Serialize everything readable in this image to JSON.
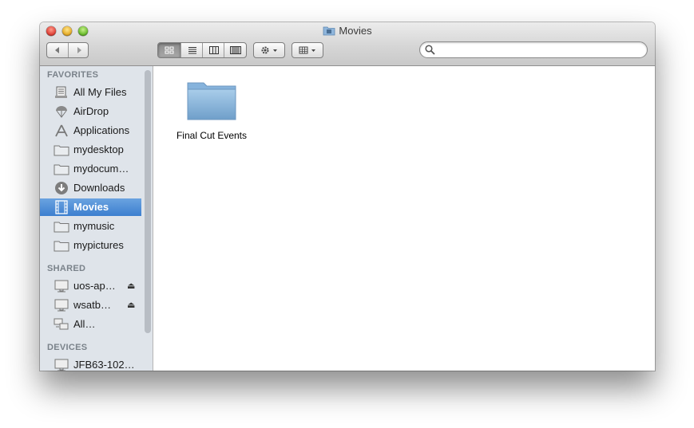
{
  "window": {
    "title": "Movies"
  },
  "toolbar": {
    "search_placeholder": ""
  },
  "sidebar": {
    "sections": {
      "favorites": "FAVORITES",
      "shared": "SHARED",
      "devices": "DEVICES"
    },
    "favorites": [
      {
        "label": "All My Files",
        "icon": "all-files-icon"
      },
      {
        "label": "AirDrop",
        "icon": "airdrop-icon"
      },
      {
        "label": "Applications",
        "icon": "applications-icon"
      },
      {
        "label": "mydesktop",
        "icon": "folder-icon"
      },
      {
        "label": "mydocum…",
        "icon": "folder-icon"
      },
      {
        "label": "Downloads",
        "icon": "downloads-icon"
      },
      {
        "label": "Movies",
        "icon": "movies-icon",
        "selected": true
      },
      {
        "label": "mymusic",
        "icon": "folder-icon"
      },
      {
        "label": "mypictures",
        "icon": "folder-icon"
      }
    ],
    "shared": [
      {
        "label": "uos-ap…",
        "icon": "server-icon",
        "eject": "⏏"
      },
      {
        "label": "wsatb…",
        "icon": "server-icon",
        "eject": "⏏"
      },
      {
        "label": "All…",
        "icon": "network-icon"
      }
    ],
    "devices": [
      {
        "label": "JFB63-102…",
        "icon": "computer-icon"
      }
    ]
  },
  "content": {
    "items": [
      {
        "label": "Final Cut Events",
        "icon": "folder-icon"
      }
    ]
  },
  "colors": {
    "selection": "#3d7fcf",
    "sidebar_bg": "#dfe4ea"
  }
}
